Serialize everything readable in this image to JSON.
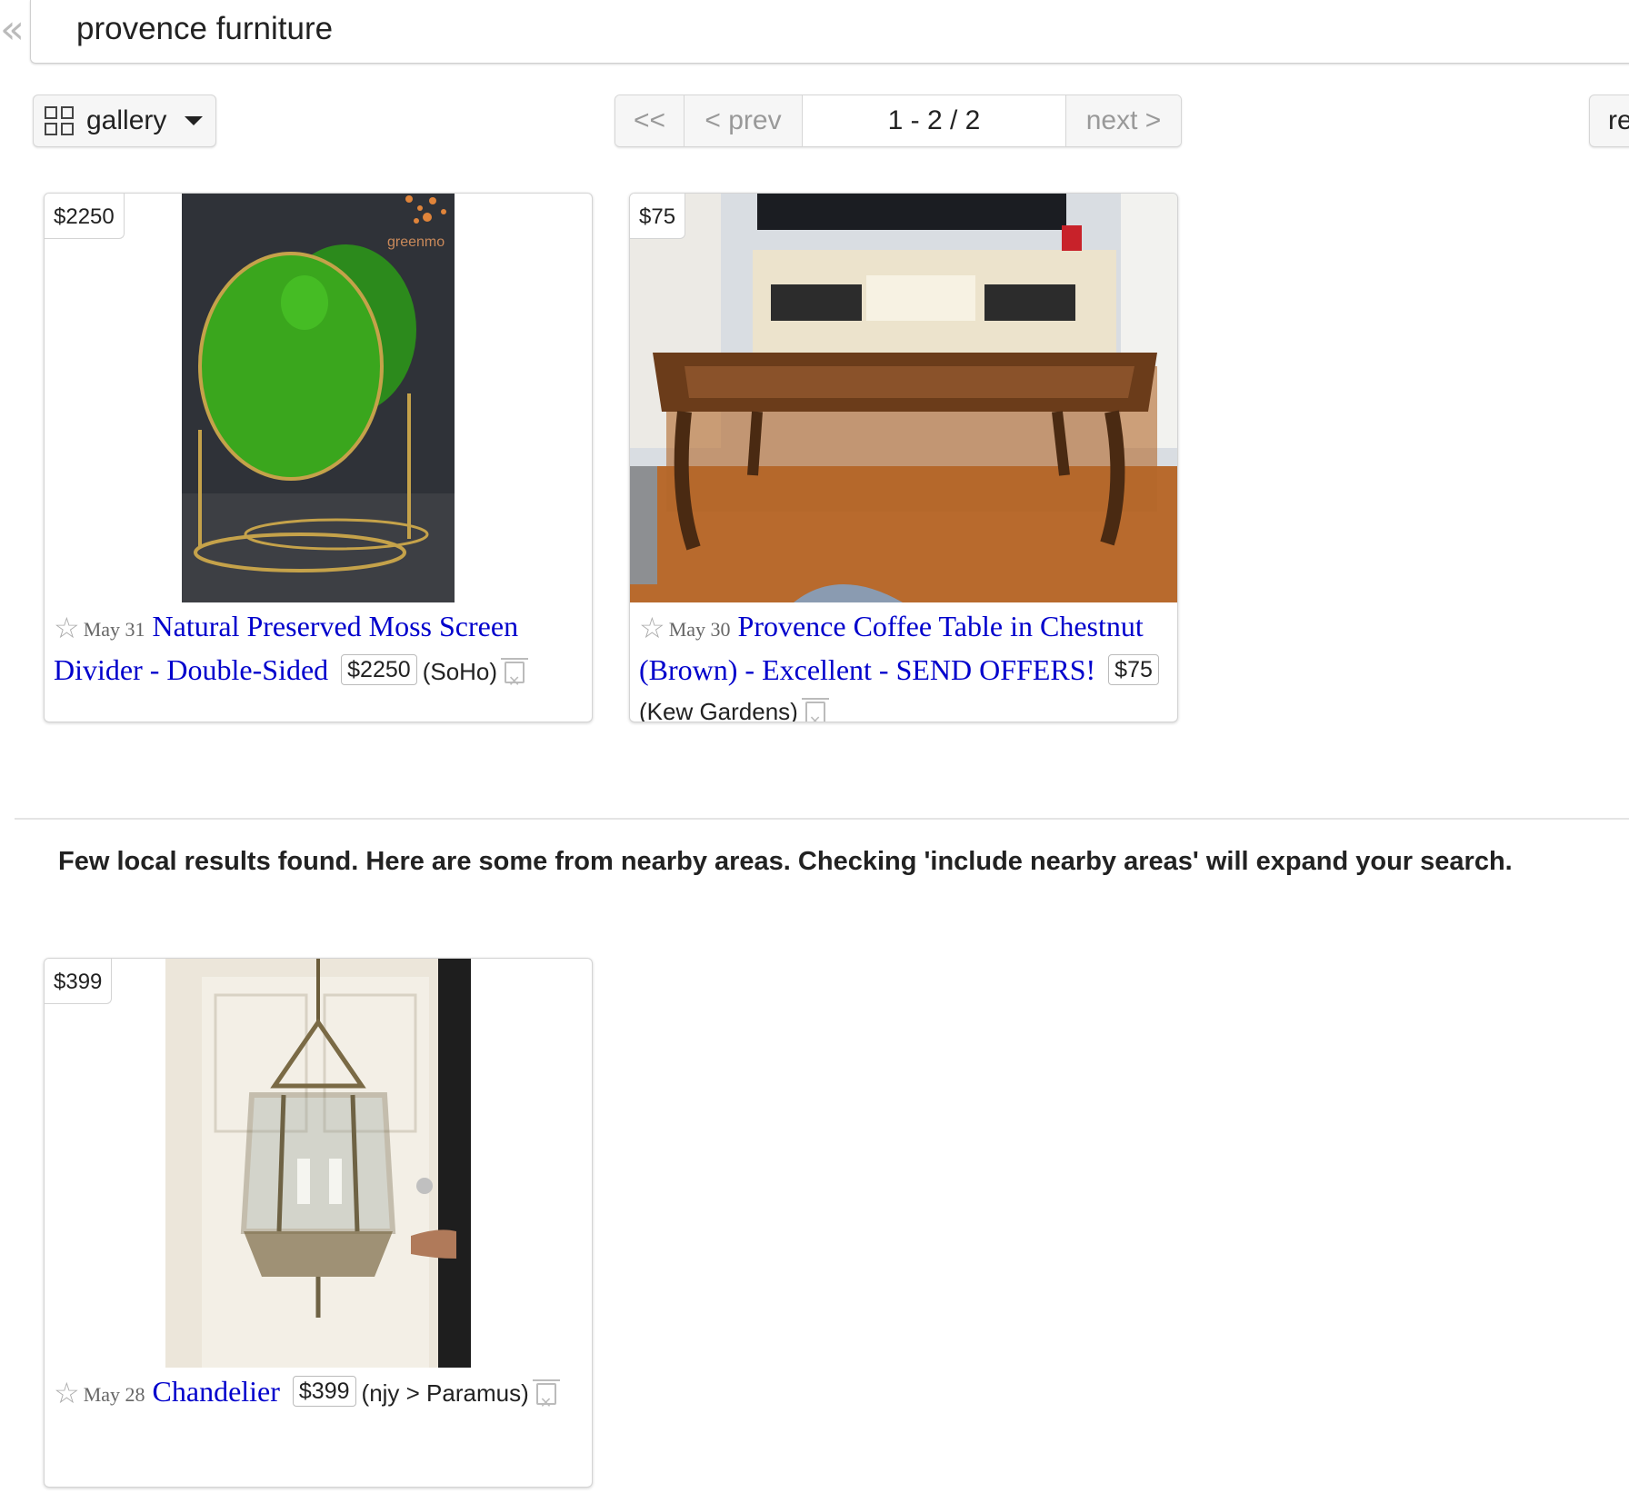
{
  "search": {
    "value": "provence furniture",
    "collapse_label": "«"
  },
  "toolbar": {
    "view_label": "gallery",
    "pager": {
      "first": "<<",
      "prev": "< prev",
      "range": "1 - 2 / 2",
      "next": "next >"
    },
    "right_button_label": "re"
  },
  "results": [
    {
      "price_tag": "$2250",
      "date": "May 31",
      "title": "Natural Preserved Moss Screen Divider - Double-Sided",
      "price": "$2250",
      "hood": "(SoHo)",
      "brand_text": "greenmo"
    },
    {
      "price_tag": "$75",
      "date": "May 30",
      "title": "Provence Coffee Table in Chestnut (Brown) - Excellent - SEND OFFERS!",
      "price": "$75",
      "hood": "(Kew Gardens)"
    }
  ],
  "nearby_message": "Few local results found. Here are some from nearby areas. Checking 'include nearby areas' will expand your search.",
  "nearby_results": [
    {
      "price_tag": "$399",
      "date": "May 28",
      "title": "Chandelier",
      "price": "$399",
      "hood": "(njy > Paramus)"
    }
  ],
  "icons": {
    "star": "star-icon",
    "hide": "trash-hide-icon",
    "view": "grid-icon",
    "dropdown": "caret-down-icon"
  }
}
